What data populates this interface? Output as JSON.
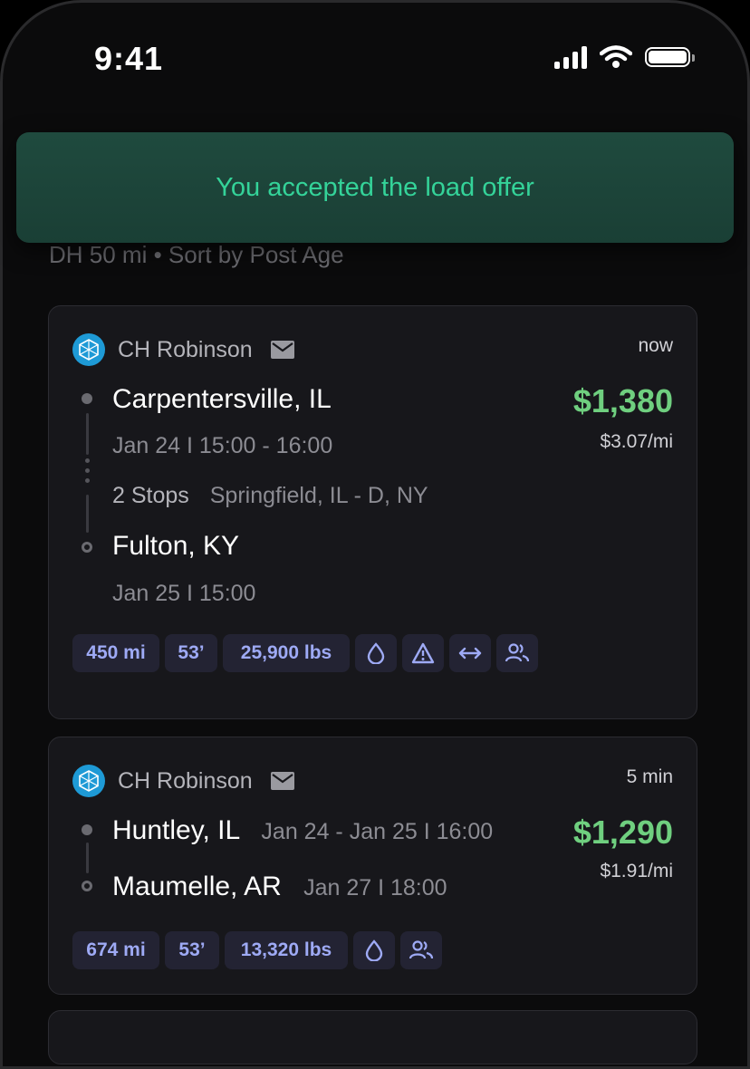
{
  "status_bar": {
    "time": "9:41"
  },
  "toast": {
    "message": "You accepted the load offer"
  },
  "filters": {
    "text": "DH 50 mi  • Sort by Post Age"
  },
  "loads": [
    {
      "broker": "CH Robinson",
      "age": "now",
      "price": "$1,380",
      "rate": "$3.07/mi",
      "origin": "Carpentersville, IL",
      "origin_time": "Jan 24 I 15:00 - 16:00",
      "stops_label": "2 Stops",
      "stops_detail": "Springfield, IL - D, NY",
      "destination": "Fulton, KY",
      "destination_time": "Jan 25 I 15:00",
      "chips": [
        "450 mi",
        "53’",
        "25,900 lbs"
      ],
      "icons": [
        "drop-icon",
        "hazmat-warning-icon",
        "arrows-horizontal-icon",
        "team-drivers-icon"
      ]
    },
    {
      "broker": "CH Robinson",
      "age": "5 min",
      "price": "$1,290",
      "rate": "$1.91/mi",
      "origin": "Huntley, IL",
      "origin_time": "Jan 24 - Jan 25 I 16:00",
      "destination": "Maumelle, AR",
      "destination_time": "Jan 27 I 18:00",
      "chips": [
        "674 mi",
        "53’",
        "13,320 lbs"
      ],
      "icons": [
        "drop-icon",
        "team-drivers-icon"
      ]
    }
  ],
  "colors": {
    "accent_green": "#34d399",
    "price_green": "#6fcf7f",
    "chip_text": "#9eaaf5",
    "broker_blue": "#1e9ad6"
  }
}
